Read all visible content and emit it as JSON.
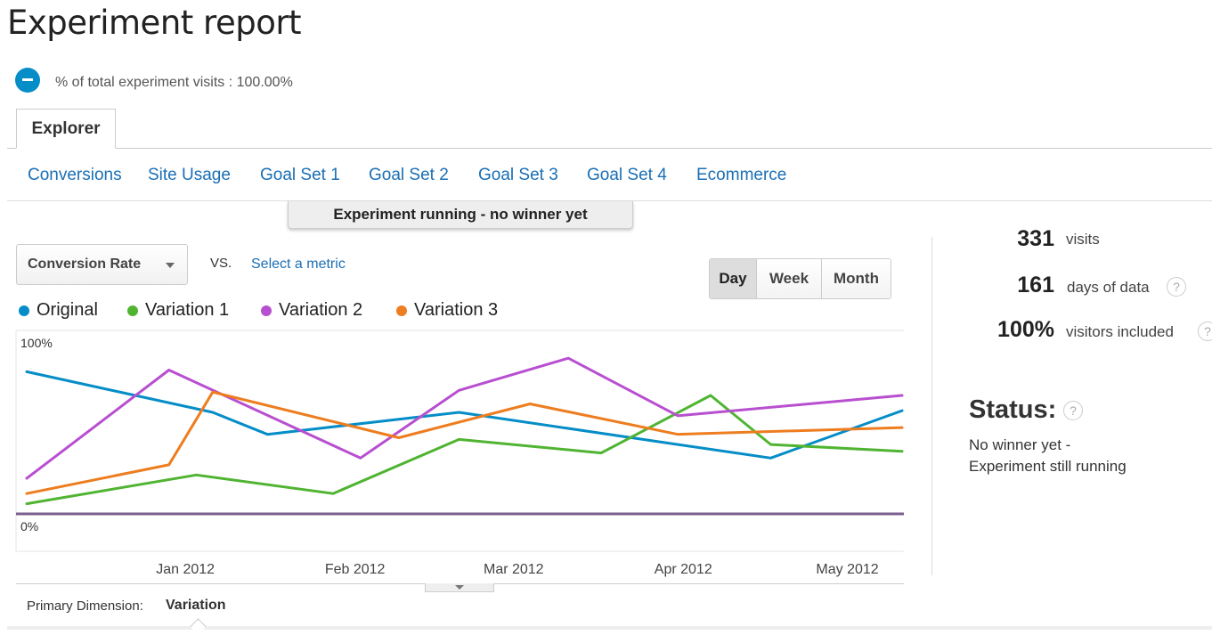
{
  "page": {
    "title": "Experiment report"
  },
  "segment": {
    "text": "% of total experiment visits : 100.00%"
  },
  "tabs": {
    "explorer": "Explorer"
  },
  "subtabs": [
    {
      "label": "Conversions",
      "active": true
    },
    {
      "label": "Site Usage",
      "active": false
    },
    {
      "label": "Goal Set 1",
      "active": false
    },
    {
      "label": "Goal Set 2",
      "active": false
    },
    {
      "label": "Goal Set 3",
      "active": false
    },
    {
      "label": "Goal Set 4",
      "active": false
    },
    {
      "label": "Ecommerce",
      "active": false
    }
  ],
  "banner": {
    "text": "Experiment running - no winner yet"
  },
  "controls": {
    "metric": "Conversion Rate",
    "vs": "VS.",
    "select_metric": "Select a metric",
    "periods": [
      "Day",
      "Week",
      "Month"
    ],
    "active_period": "Day"
  },
  "colors": {
    "original": "#058dc7",
    "variation1": "#50b432",
    "variation2": "#b84fd0",
    "variation3": "#ed7d1f",
    "baseline": "#7b5f8e"
  },
  "chart_data": {
    "type": "line",
    "ytick_labels": [
      "100%",
      "0%"
    ],
    "ylim": [
      0,
      100
    ],
    "x_labels": [
      "Jan 2012",
      "Feb 2012",
      "Mar 2012",
      "Apr 2012",
      "May 2012"
    ],
    "x": [
      "2011-12-03",
      "2011-12-29",
      "2012-01-03",
      "2012-01-06",
      "2012-01-16",
      "2012-01-28",
      "2012-02-02",
      "2012-02-09",
      "2012-02-20",
      "2012-03-04",
      "2012-03-11",
      "2012-03-17",
      "2012-03-31",
      "2012-04-06",
      "2012-04-17",
      "2012-05-01",
      "2012-05-11"
    ],
    "series": [
      {
        "name": "Original",
        "color_key": "original",
        "points": [
          [
            "2011-12-03",
            84
          ],
          [
            "2012-01-06",
            60
          ],
          [
            "2012-01-16",
            47
          ],
          [
            "2012-02-20",
            60
          ],
          [
            "2012-03-31",
            41
          ],
          [
            "2012-04-17",
            33
          ],
          [
            "2012-05-11",
            61
          ]
        ]
      },
      {
        "name": "Variation 1",
        "color_key": "variation1",
        "points": [
          [
            "2011-12-03",
            6
          ],
          [
            "2012-01-03",
            23
          ],
          [
            "2012-01-28",
            12
          ],
          [
            "2012-02-20",
            44
          ],
          [
            "2012-03-17",
            36
          ],
          [
            "2012-04-06",
            70
          ],
          [
            "2012-04-17",
            41
          ],
          [
            "2012-05-11",
            37
          ]
        ]
      },
      {
        "name": "Variation 2",
        "color_key": "variation2",
        "points": [
          [
            "2011-12-03",
            21
          ],
          [
            "2011-12-29",
            85
          ],
          [
            "2012-02-02",
            33
          ],
          [
            "2012-02-20",
            73
          ],
          [
            "2012-03-11",
            92
          ],
          [
            "2012-03-31",
            58
          ],
          [
            "2012-05-11",
            70
          ]
        ]
      },
      {
        "name": "Variation 3",
        "color_key": "variation3",
        "points": [
          [
            "2011-12-03",
            12
          ],
          [
            "2011-12-29",
            29
          ],
          [
            "2012-01-06",
            72
          ],
          [
            "2012-02-09",
            45
          ],
          [
            "2012-03-04",
            65
          ],
          [
            "2012-03-31",
            47
          ],
          [
            "2012-05-11",
            51
          ]
        ]
      }
    ],
    "baseline_value": 0,
    "grid": true
  },
  "stats": [
    {
      "value": "331",
      "label": "visits",
      "help": false
    },
    {
      "value": "161",
      "label": "days of data",
      "help": true
    },
    {
      "value": "100%",
      "label": "visitors included",
      "help": true
    }
  ],
  "status": {
    "title": "Status:",
    "line1": "No winner yet -",
    "line2": "Experiment still running"
  },
  "dimension": {
    "label": "Primary Dimension:",
    "value": "Variation"
  },
  "help_glyph": "?"
}
